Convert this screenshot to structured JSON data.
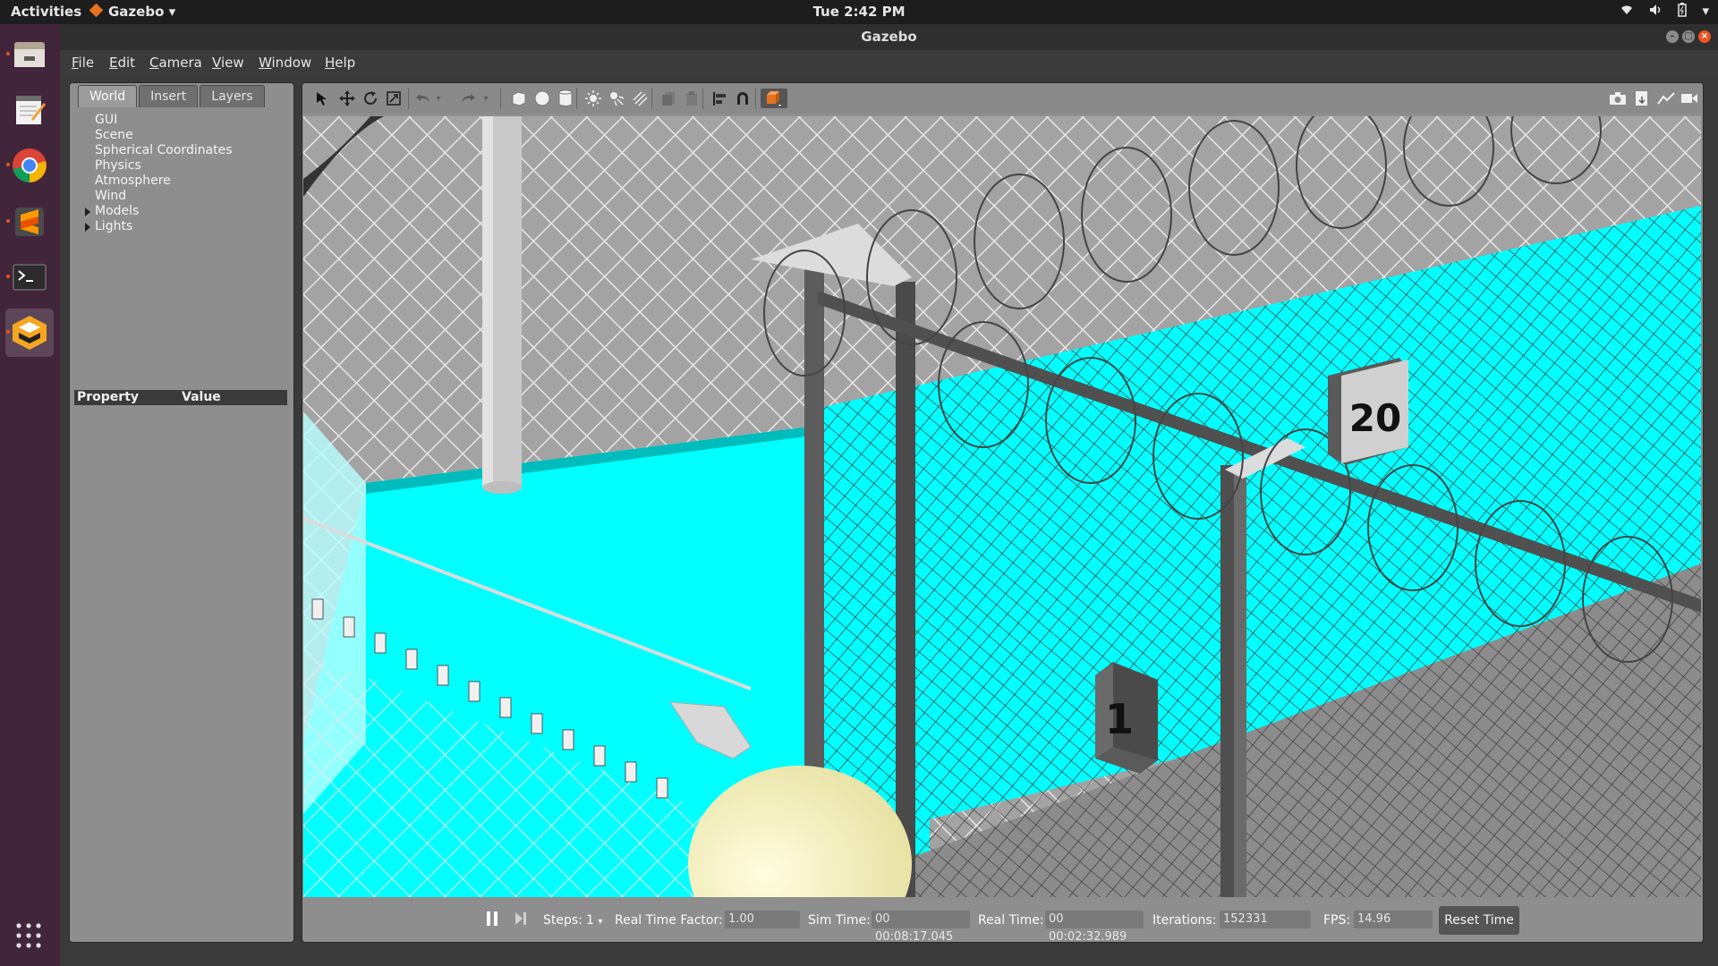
{
  "topbar": {
    "activities": "Activities",
    "app_menu": "Gazebo",
    "clock": "Tue  2:42 PM"
  },
  "dock": {
    "items": [
      {
        "name": "files-icon"
      },
      {
        "name": "text-editor-icon"
      },
      {
        "name": "chrome-icon"
      },
      {
        "name": "sublime-text-icon"
      },
      {
        "name": "terminal-icon"
      },
      {
        "name": "gazebo-icon"
      }
    ],
    "show_apps": "show-applications-icon"
  },
  "window": {
    "title": "Gazebo"
  },
  "menubar": {
    "items": [
      "File",
      "Edit",
      "Camera",
      "View",
      "Window",
      "Help"
    ]
  },
  "left_panel": {
    "tabs": [
      "World",
      "Insert",
      "Layers"
    ],
    "active_tab": "World",
    "tree": [
      "GUI",
      "Scene",
      "Spherical Coordinates",
      "Physics",
      "Atmosphere",
      "Wind",
      "Models",
      "Lights"
    ],
    "expandable": [
      "Models",
      "Lights"
    ],
    "property_header": "Property",
    "value_header": "Value"
  },
  "scene": {
    "sign_labels": [
      "20",
      "1"
    ],
    "sky_color": "#00ffff",
    "fence_color": "#9c9c9c"
  },
  "bottom_bar": {
    "steps_label": "Steps:",
    "steps_value": "1",
    "rtf_label": "Real Time Factor:",
    "rtf_value": "1.00",
    "sim_time_label": "Sim Time:",
    "sim_time_value": "00 00:08:17.045",
    "real_time_label": "Real Time:",
    "real_time_value": "00 00:02:32.989",
    "iterations_label": "Iterations:",
    "iterations_value": "152331",
    "fps_label": "FPS:",
    "fps_value": "14.96",
    "reset_label": "Reset Time"
  }
}
